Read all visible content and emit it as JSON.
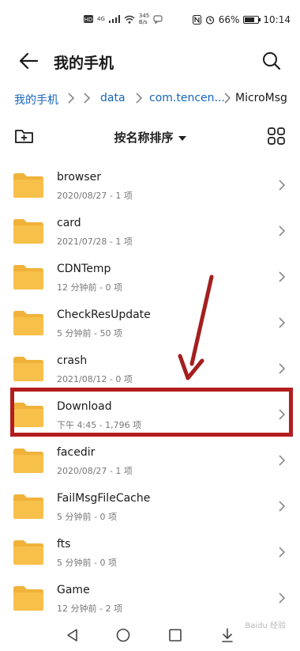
{
  "status_bar": {
    "network": "4G",
    "speed_value": "345",
    "speed_unit": "B/s",
    "battery_pct": "66%",
    "battery_level": 0.66,
    "time": "10:14",
    "icons": [
      "hd-icon",
      "signal-icon",
      "wifi-icon",
      "nfc-icon",
      "alarm-icon",
      "battery-icon"
    ]
  },
  "header": {
    "title": "我的手机"
  },
  "breadcrumb": {
    "items": [
      "我的手机",
      "data",
      "com.tencen...",
      "MicroMsg"
    ]
  },
  "toolbar": {
    "sort_label": "按名称排序"
  },
  "files": [
    {
      "name": "browser",
      "meta": "2020/08/27 - 1 项"
    },
    {
      "name": "card",
      "meta": "2021/07/28 - 1 项"
    },
    {
      "name": "CDNTemp",
      "meta": "12 分钟前 - 0 项"
    },
    {
      "name": "CheckResUpdate",
      "meta": "5 分钟前 - 50 项"
    },
    {
      "name": "crash",
      "meta": "2021/08/12 - 0 项"
    },
    {
      "name": "Download",
      "meta": "下午 4:45 - 1,796 项"
    },
    {
      "name": "facedir",
      "meta": "2020/08/27 - 1 项"
    },
    {
      "name": "FailMsgFileCache",
      "meta": "5 分钟前 - 0 项"
    },
    {
      "name": "fts",
      "meta": "5 分钟前 - 0 项"
    },
    {
      "name": "Game",
      "meta": "12 分钟前 - 2 项"
    }
  ],
  "colors": {
    "folder": "#f7c04a",
    "folder_tab": "#f0b23a",
    "link": "#1565c0",
    "highlight": "#b31d1d"
  },
  "watermark": "Baidu 经验"
}
